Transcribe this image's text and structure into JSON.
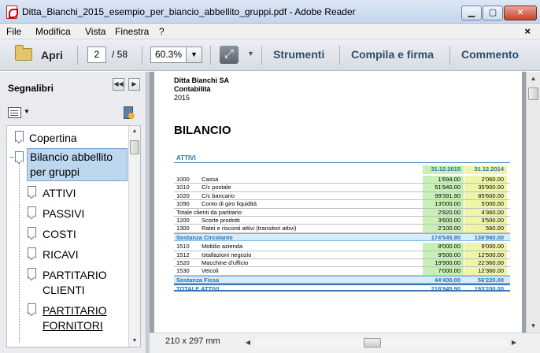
{
  "window": {
    "title": "Ditta_Bianchi_2015_esempio_per_biancio_abbellito_gruppi.pdf - Adobe Reader",
    "min_glyph": "▁",
    "max_glyph": "▢",
    "close_glyph": "✕"
  },
  "menu": {
    "items": [
      "File",
      "Modifica",
      "Vista",
      "Finestra",
      "?"
    ],
    "close_glyph": "×"
  },
  "toolbar": {
    "open_label": "Apri",
    "page_current": "2",
    "page_total": "/ 58",
    "zoom": "60.3%",
    "tools_label": "Strumenti",
    "fill_sign_label": "Compila e firma",
    "comment_label": "Commento"
  },
  "sidebar": {
    "title": "Segnalibri",
    "bookmarks": [
      {
        "label": "Copertina"
      },
      {
        "label": "Bilancio abbellito",
        "label2": "per gruppi",
        "selected": true
      },
      {
        "label": "ATTIVI"
      },
      {
        "label": "PASSIVI"
      },
      {
        "label": "COSTI"
      },
      {
        "label": "RICAVI"
      },
      {
        "label": "PARTITARIO",
        "label2": "CLIENTI"
      },
      {
        "label": "PARTITARIO",
        "label2": "FORNITORI"
      }
    ]
  },
  "document": {
    "company": "Ditta Bianchi SA",
    "department": "Contabilità",
    "year": "2015",
    "heading": "BILANCIO",
    "section": "ATTIVI",
    "col1": "31.12.2015",
    "col2": "31.12.2014",
    "rows": [
      {
        "code": "1000",
        "desc": "Cassa",
        "v1": "1'694.00",
        "v2": "2'060.00"
      },
      {
        "code": "1010",
        "desc": "C/c postale",
        "v1": "51'940.00",
        "v2": "35'900.00"
      },
      {
        "code": "1020",
        "desc": "C/c bancario",
        "v1": "99'391.90",
        "v2": "85'600.00"
      },
      {
        "code": "1090",
        "desc": "Conto di giro liquidità",
        "v1": "13'000.00",
        "v2": "5'000.00"
      },
      {
        "code": "",
        "desc": "Totale clienti da partitario",
        "v1": "2'820.00",
        "v2": "4'360.00"
      },
      {
        "code": "1200",
        "desc": "Scorte prodotti",
        "v1": "3'600.00",
        "v2": "3'500.00"
      },
      {
        "code": "1300",
        "desc": "Ratei e risconti attivi (transitori attivi)",
        "v1": "2'100.00",
        "v2": "560.00"
      }
    ],
    "subtotal1": {
      "desc": "Sostanza Circolante",
      "v1": "174'545.90",
      "v2": "136'980.00"
    },
    "rows2": [
      {
        "code": "1510",
        "desc": "Mobilio azienda",
        "v1": "8'000.00",
        "v2": "9'000.00"
      },
      {
        "code": "1512",
        "desc": "Istallazioni negozio",
        "v1": "9'500.00",
        "v2": "12'500.00"
      },
      {
        "code": "1520",
        "desc": "Macchine d'ufficio",
        "v1": "19'900.00",
        "v2": "22'360.00"
      },
      {
        "code": "1530",
        "desc": "Veicoli",
        "v1": "7'000.00",
        "v2": "12'360.00"
      }
    ],
    "subtotal2": {
      "desc": "Sostanza Fissa",
      "v1": "44'400.00",
      "v2": "56'220.00"
    },
    "total": {
      "desc": "TOTALE ATTIVI",
      "v1": "218'945.90",
      "v2": "193'200.00"
    }
  },
  "status": {
    "page_size": "210 x 297 mm"
  },
  "colors": {
    "accent_blue": "#2c6fb0",
    "col1_bg": "#c8f0b6",
    "col2_bg": "#eef5a8"
  }
}
